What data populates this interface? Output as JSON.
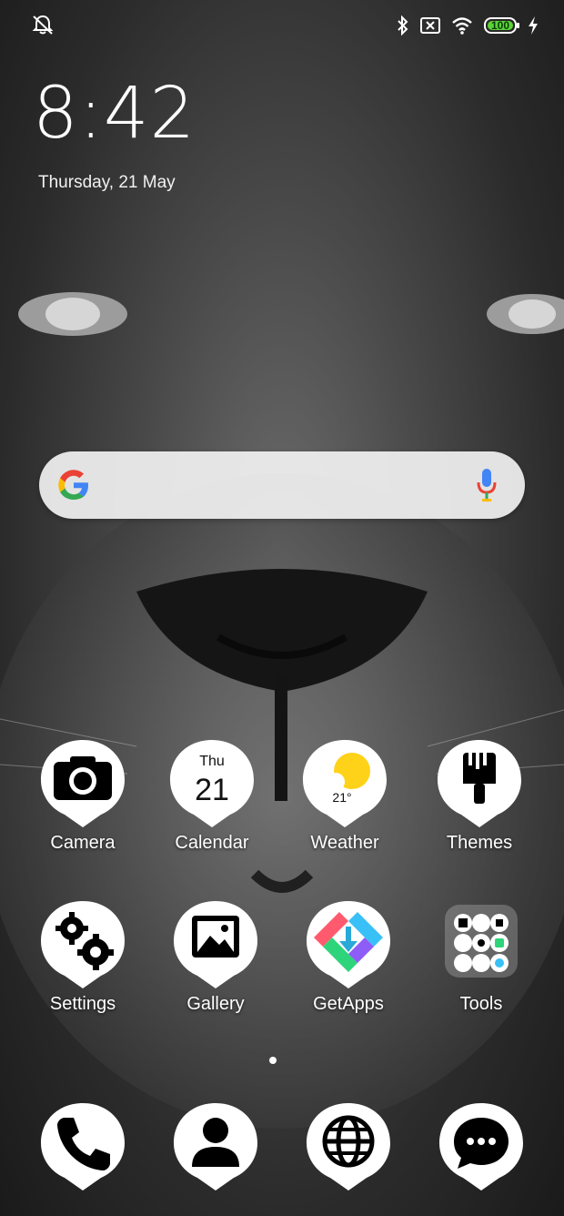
{
  "status_bar": {
    "left_icon": "notifications-muted-icon",
    "right_icons": [
      "bluetooth-icon",
      "no-sim-icon",
      "wifi-icon"
    ],
    "battery_level": "100",
    "charging_icon": "lightning-icon"
  },
  "clock": {
    "time": "8:42",
    "date": "Thursday, 21 May"
  },
  "search": {
    "logo": "google-g-icon",
    "mic": "mic-icon"
  },
  "apps": {
    "row1": [
      {
        "label": "Camera",
        "icon": "camera-icon"
      },
      {
        "label": "Calendar",
        "icon": "calendar-icon",
        "day": "Thu",
        "date": "21"
      },
      {
        "label": "Weather",
        "icon": "weather-icon",
        "temp": "21°"
      },
      {
        "label": "Themes",
        "icon": "brush-icon"
      }
    ],
    "row2": [
      {
        "label": "Settings",
        "icon": "gears-icon"
      },
      {
        "label": "Gallery",
        "icon": "gallery-icon"
      },
      {
        "label": "GetApps",
        "icon": "getapps-icon"
      },
      {
        "label": "Tools",
        "icon": "folder-icon"
      }
    ],
    "dock": [
      {
        "label": "",
        "icon": "phone-icon"
      },
      {
        "label": "",
        "icon": "contacts-icon"
      },
      {
        "label": "",
        "icon": "globe-icon"
      },
      {
        "label": "",
        "icon": "messages-icon"
      }
    ]
  },
  "colors": {
    "badge": "#ffffff",
    "battery": "#5bd435",
    "google_blue": "#4285F4",
    "google_red": "#EA4335",
    "google_yellow": "#FBBC05",
    "google_green": "#34A853"
  }
}
